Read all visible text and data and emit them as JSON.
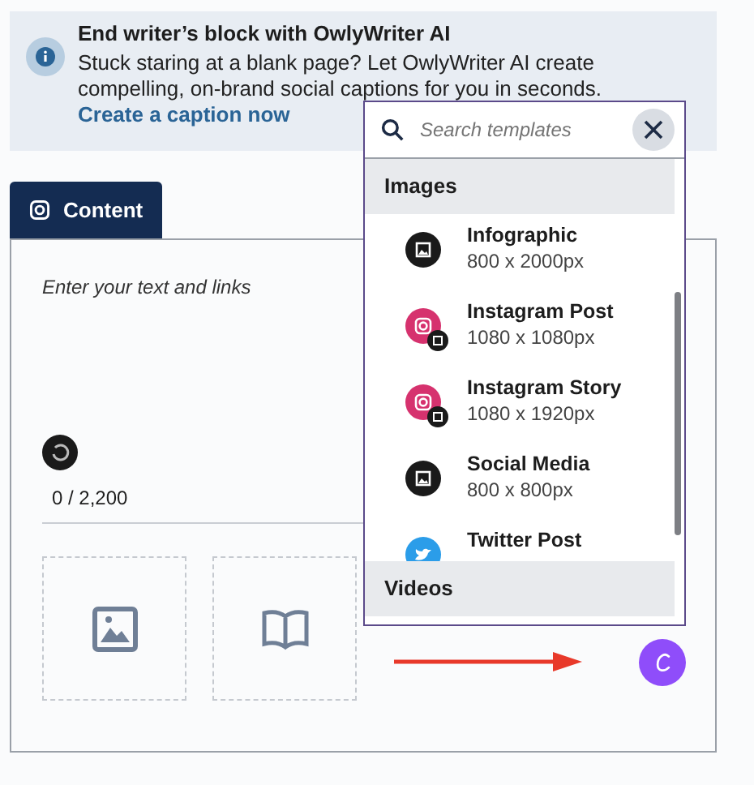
{
  "banner": {
    "title": "End writer’s block with OwlyWriter AI",
    "text": "Stuck staring at a blank page? Let OwlyWriter AI create compelling, on-brand social captions for you in seconds.",
    "link": "Create a caption now"
  },
  "tabs": [
    {
      "label": "Content",
      "selected": true
    }
  ],
  "editor": {
    "placeholder": "Enter your text and links",
    "counter": "0 / 2,200"
  },
  "popup": {
    "search": {
      "placeholder": "Search templates"
    },
    "sections": [
      {
        "title": "Images",
        "items": [
          {
            "kind": "image",
            "name": "Infographic",
            "size": "800 x 2000px"
          },
          {
            "kind": "instagram",
            "name": "Instagram Post",
            "size": "1080 x 1080px"
          },
          {
            "kind": "instagram",
            "name": "Instagram Story",
            "size": "1080 x 1920px"
          },
          {
            "kind": "image",
            "name": "Social Media",
            "size": "800 x 800px"
          },
          {
            "kind": "twitter",
            "name": "Twitter Post"
          }
        ]
      },
      {
        "title": "Videos"
      }
    ]
  }
}
